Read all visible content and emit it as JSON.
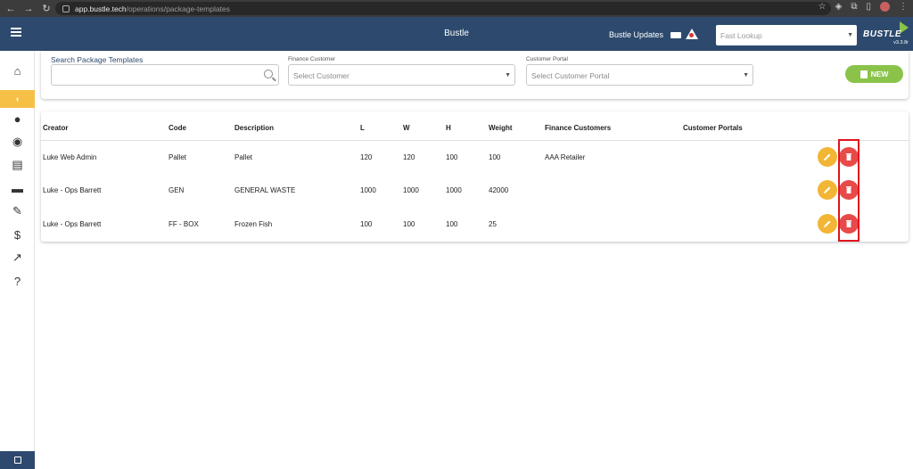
{
  "browser": {
    "url_host": "app.bustle.tech",
    "url_path": "/operations/package-templates"
  },
  "app": {
    "title": "Bustle",
    "updates_label": "Bustle Updates",
    "lookup_placeholder": "Fast Lookup",
    "logo_text": "BUSTLE",
    "version": "v3.3.8r"
  },
  "sidebar": {
    "items": [
      {
        "name": "home-icon"
      },
      {
        "name": "collapse-chevron-icon"
      },
      {
        "name": "user-icon"
      },
      {
        "name": "packages-icon"
      },
      {
        "name": "list-icon"
      },
      {
        "name": "bed-icon"
      },
      {
        "name": "wrench-icon"
      },
      {
        "name": "dollar-icon"
      },
      {
        "name": "chart-icon"
      },
      {
        "name": "help-icon"
      }
    ],
    "glyphs": [
      "⌂",
      "‹",
      "●",
      "◉",
      "▤",
      "▬",
      "✎",
      "$",
      "↗",
      "?"
    ]
  },
  "filters": {
    "search_label": "Search Package Templates",
    "search_value": "",
    "finance_label": "Finance Customer",
    "finance_placeholder": "Select Customer",
    "portal_label": "Customer Portal",
    "portal_placeholder": "Select Customer Portal",
    "new_label": "NEW"
  },
  "table": {
    "headers": {
      "creator": "Creator",
      "code": "Code",
      "description": "Description",
      "l": "L",
      "w": "W",
      "h": "H",
      "weight": "Weight",
      "finance_customers": "Finance Customers",
      "customer_portals": "Customer Portals"
    },
    "rows": [
      {
        "creator": "Luke Web Admin",
        "code": "Pallet",
        "description": "Pallet",
        "l": "120",
        "w": "120",
        "h": "100",
        "weight": "100",
        "finance_customers": "AAA Retailer",
        "customer_portals": ""
      },
      {
        "creator": "Luke - Ops Barrett",
        "code": "GEN",
        "description": "GENERAL WASTE",
        "l": "1000",
        "w": "1000",
        "h": "1000",
        "weight": "42000",
        "finance_customers": "",
        "customer_portals": ""
      },
      {
        "creator": "Luke - Ops Barrett",
        "code": "FF - BOX",
        "description": "Frozen Fish",
        "l": "100",
        "w": "100",
        "h": "100",
        "weight": "25",
        "finance_customers": "",
        "customer_portals": ""
      }
    ]
  },
  "colors": {
    "header_bg": "#2d4a6e",
    "accent_yellow": "#f6c047",
    "edit": "#f2b534",
    "delete": "#e84a4a",
    "new_button": "#8bc34a",
    "highlight": "#e0141e"
  }
}
